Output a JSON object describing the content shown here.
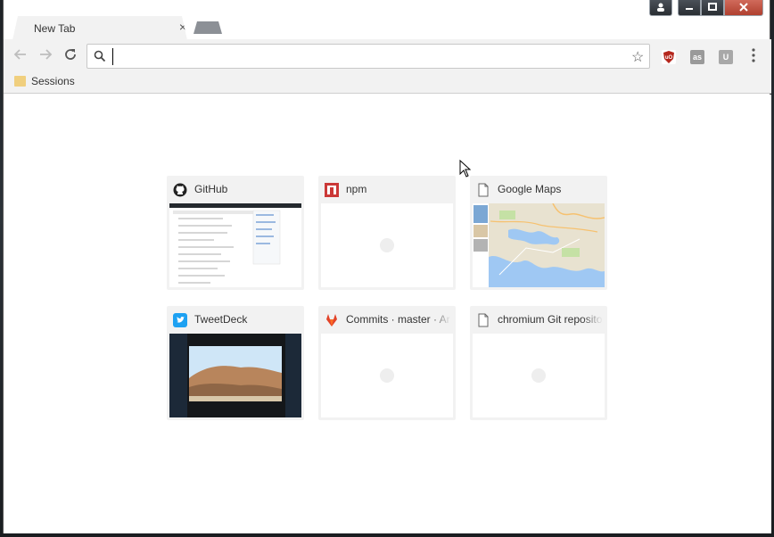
{
  "tabs": [
    {
      "title": "New Tab",
      "close_glyph": "×"
    }
  ],
  "window_controls": {
    "user": "user-icon",
    "minimize": "minimize-icon",
    "maximize": "maximize-icon",
    "close": "close-icon"
  },
  "omnibox": {
    "value": "",
    "placeholder": ""
  },
  "extensions": [
    {
      "name": "ublock-origin-icon",
      "label": "uO",
      "color": "#b5271d"
    },
    {
      "name": "lastfm-icon",
      "label": "as",
      "color": "#9a9a9a"
    },
    {
      "name": "u-extension-icon",
      "label": "U",
      "color": "#a8a8a8"
    }
  ],
  "bookmarks_bar": {
    "items": [
      {
        "label": "Sessions",
        "icon": "folder-icon"
      }
    ]
  },
  "most_visited": [
    {
      "title": "GitHub",
      "icon": "github-icon",
      "thumbnail": "github"
    },
    {
      "title": "npm",
      "icon": "npm-icon",
      "thumbnail": "blank"
    },
    {
      "title": "Google Maps",
      "icon": "page-icon",
      "thumbnail": "maps"
    },
    {
      "title": "TweetDeck",
      "icon": "tweetdeck-icon",
      "thumbnail": "tweetdeck"
    },
    {
      "title": "Commits · master · Ar",
      "icon": "gitlab-icon",
      "thumbnail": "blank"
    },
    {
      "title": "chromium Git reposito",
      "icon": "page-icon",
      "thumbnail": "blank"
    }
  ],
  "colors": {
    "chrome_bg": "#f2f2f2",
    "tile_bg": "#f2f2f2",
    "accent_close": "#c0392b"
  }
}
